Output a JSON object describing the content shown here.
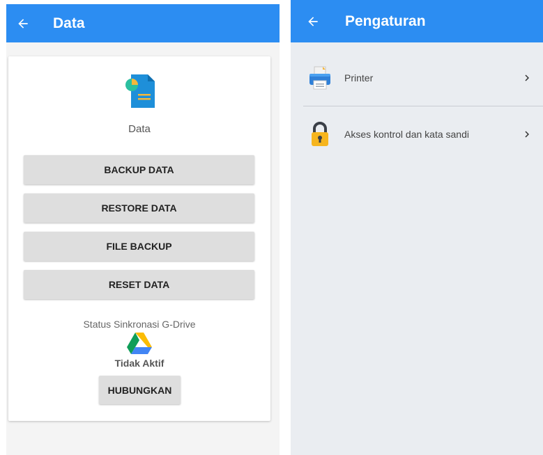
{
  "left_screen": {
    "title": "Data",
    "card": {
      "title": "Data",
      "buttons": {
        "backup": "BACKUP DATA",
        "restore": "RESTORE DATA",
        "file_backup": "FILE BACKUP",
        "reset": "RESET DATA"
      },
      "sync": {
        "label": "Status Sinkronasi G-Drive",
        "status": "Tidak Aktif",
        "connect_label": "HUBUNGKAN"
      }
    }
  },
  "right_screen": {
    "title": "Pengaturan",
    "items": [
      {
        "label": "Printer",
        "icon": "printer-icon"
      },
      {
        "label": "Akses kontrol dan kata sandi",
        "icon": "lock-icon"
      }
    ]
  },
  "colors": {
    "app_bar": "#2c8df2",
    "button_bg": "#dedede",
    "right_background": "#eaedf1"
  }
}
